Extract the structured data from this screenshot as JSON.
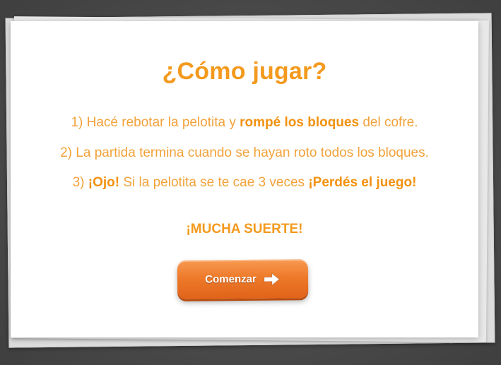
{
  "title": "¿Cómo jugar?",
  "rules": [
    {
      "parts": [
        "1) Hacé rebotar la pelotita y ",
        "rompé los bloques",
        " del cofre."
      ]
    },
    {
      "parts": [
        "2) La partida termina cuando se hayan roto todos los bloques."
      ]
    },
    {
      "parts": [
        "3) ",
        "¡Ojo!",
        " Si la pelotita se te cae 3 veces ",
        "¡Perdés el juego!"
      ]
    }
  ],
  "good_luck": "¡MUCHA SUERTE!",
  "button": {
    "label": "Comenzar",
    "icon": "arrow-right-icon"
  },
  "colors": {
    "accent": "#f39a1e",
    "button": "#ee7a2a",
    "background": "#4b4b4b"
  }
}
